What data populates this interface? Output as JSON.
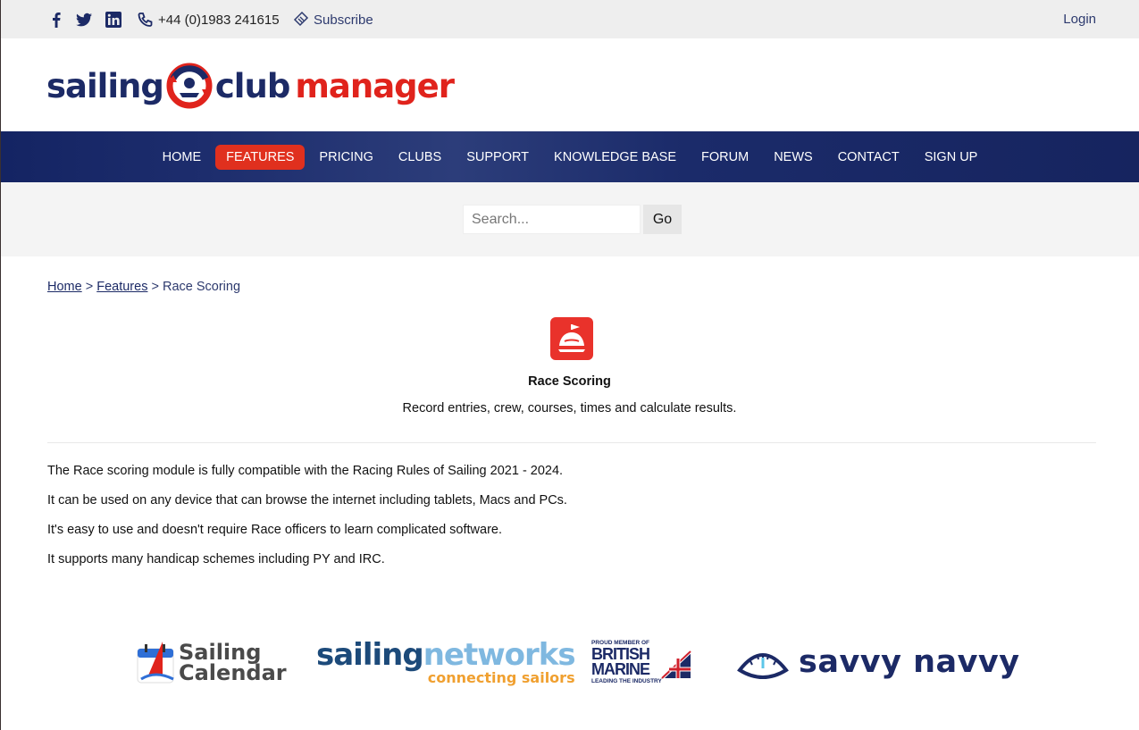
{
  "topbar": {
    "phone": "+44 (0)1983 241615",
    "subscribe": "Subscribe",
    "login": "Login",
    "icons": [
      "facebook-icon",
      "twitter-icon",
      "linkedin-icon",
      "phone-icon",
      "subscribe-icon"
    ]
  },
  "logo": {
    "word1": "sailing",
    "word2": "club",
    "word3": "manager"
  },
  "nav": {
    "items": [
      "HOME",
      "FEATURES",
      "PRICING",
      "CLUBS",
      "SUPPORT",
      "KNOWLEDGE BASE",
      "FORUM",
      "NEWS",
      "CONTACT",
      "SIGN UP"
    ],
    "active_index": 1
  },
  "search": {
    "placeholder": "Search...",
    "button": "Go"
  },
  "breadcrumb": {
    "home": "Home",
    "sep1": " > ",
    "features": "Features",
    "sep2": " > ",
    "current": "Race Scoring"
  },
  "feature": {
    "title": "Race Scoring",
    "subtitle": "Record entries, crew, courses, times and calculate results."
  },
  "body": [
    "The Race scoring module is fully compatible with the Racing Rules of Sailing 2021 - 2024.",
    "It can be used on any device that can browse the internet including tablets, Macs and PCs.",
    "It's easy to use and doesn't require Race officers to learn complicated software.",
    "It supports many handicap schemes including PY and IRC."
  ],
  "sponsors": {
    "sailing_calendar": {
      "line1": "Sailing",
      "line2": "Calendar"
    },
    "sailing_networks": {
      "w1": "sailing",
      "w2": "networks",
      "tag": "connecting sailors"
    },
    "british_marine": {
      "top": "PROUD MEMBER OF",
      "l1": "BRITISH",
      "l2": "MARINE",
      "bottom": "LEADING THE INDUSTRY"
    },
    "savvy_navvy": {
      "text": "savvy navvy"
    }
  },
  "colors": {
    "brand_navy": "#1c2a66",
    "brand_red": "#e0231c",
    "nav_active": "#e0301e"
  }
}
